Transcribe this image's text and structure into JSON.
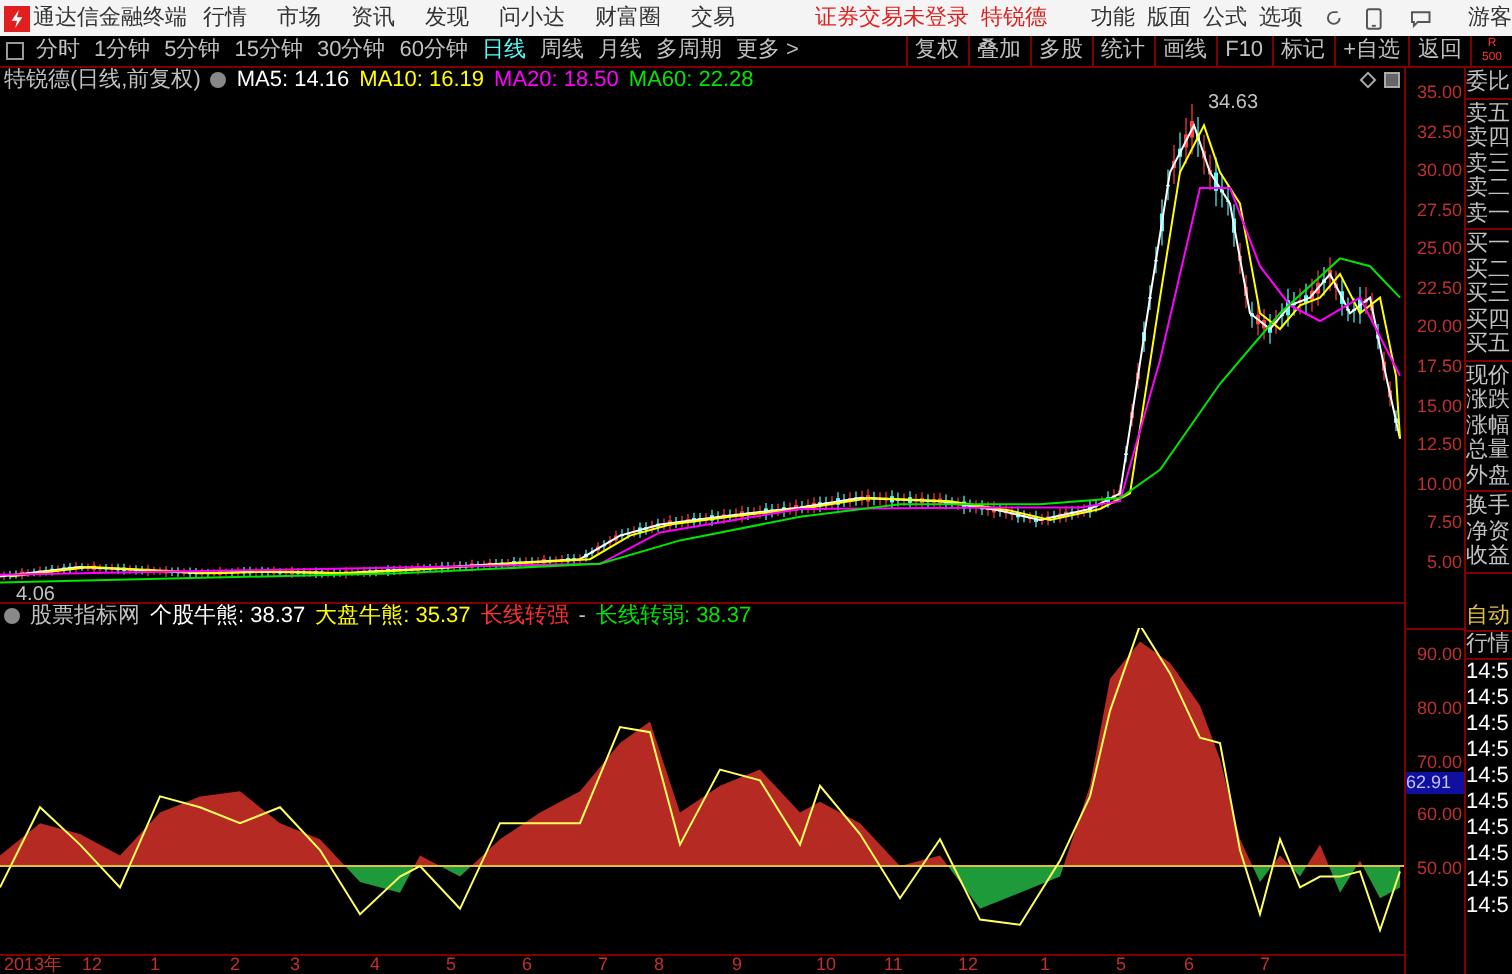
{
  "menu_bar": {
    "app_title": "通达信金融终端",
    "menus": [
      "行情",
      "市场",
      "资讯",
      "发现",
      "问小达",
      "财富圈",
      "交易"
    ],
    "login_status": "证券交易未登录",
    "stock_name": "特锐德",
    "tools": [
      "功能",
      "版面",
      "公式",
      "选项"
    ],
    "user": "游客"
  },
  "period_tabs": [
    {
      "label": "分时",
      "selected": false
    },
    {
      "label": "1分钟",
      "selected": false
    },
    {
      "label": "5分钟",
      "selected": false
    },
    {
      "label": "15分钟",
      "selected": false
    },
    {
      "label": "30分钟",
      "selected": false
    },
    {
      "label": "60分钟",
      "selected": false
    },
    {
      "label": "日线",
      "selected": true
    },
    {
      "label": "周线",
      "selected": false
    },
    {
      "label": "月线",
      "selected": false
    },
    {
      "label": "多周期",
      "selected": false
    },
    {
      "label": "更多 >",
      "selected": false
    }
  ],
  "chart_tools": [
    "复权",
    "叠加",
    "多股",
    "统计",
    "画线",
    "F10",
    "标记",
    "+自选",
    "返回"
  ],
  "corner": [
    "R",
    "500"
  ],
  "main_chart": {
    "title": "特锐德(日线,前复权)",
    "indicators": [
      {
        "label": "MA5: 14.16",
        "color": "#ffffff"
      },
      {
        "label": "MA10: 16.19",
        "color": "#ffff00"
      },
      {
        "label": "MA20: 18.50",
        "color": "#ff00ff"
      },
      {
        "label": "MA60: 22.28",
        "color": "#00e600"
      }
    ],
    "high_label": "34.63",
    "low_label": "4.06",
    "price_ticks": [
      "35.00",
      "32.50",
      "30.00",
      "27.50",
      "25.00",
      "22.50",
      "20.00",
      "17.50",
      "15.00",
      "12.50",
      "10.00",
      "7.50",
      "5.00"
    ]
  },
  "indicator_chart": {
    "source": "股票指标网",
    "legend": [
      {
        "label": "个股牛熊: 38.37",
        "color": "#ffffff"
      },
      {
        "label": "大盘牛熊: 35.37",
        "color": "#ffff00"
      },
      {
        "label": "长线转强",
        "color": "#ff3232"
      },
      {
        "label": "-",
        "color": "#c0c0c0"
      },
      {
        "label": "长线转弱: 38.37",
        "color": "#00e600"
      }
    ],
    "ticks": [
      "90.00",
      "80.00",
      "70.00",
      "60.00",
      "50.00"
    ],
    "current_value": "62.91"
  },
  "date_axis": [
    "2013年",
    "12",
    "1",
    "2",
    "3",
    "4",
    "5",
    "6",
    "7",
    "8",
    "9",
    "10",
    "11",
    "12",
    "1",
    "5",
    "6",
    "7"
  ],
  "quote_panel": {
    "groups": [
      [
        "委比"
      ],
      [
        "卖五",
        "卖四",
        "卖三",
        "卖二",
        "卖一"
      ],
      [
        "买一",
        "买二",
        "买三",
        "买四",
        "买五"
      ],
      [
        "现价",
        "涨跌",
        "涨幅",
        "总量",
        "外盘"
      ],
      [
        "换手",
        "净资",
        "收益"
      ]
    ],
    "mode": "自动",
    "tab": "行情",
    "times": [
      "14:5",
      "14:5",
      "14:5",
      "14:5",
      "14:5",
      "14:5",
      "14:5",
      "14:5",
      "14:5",
      "14:5"
    ]
  }
}
